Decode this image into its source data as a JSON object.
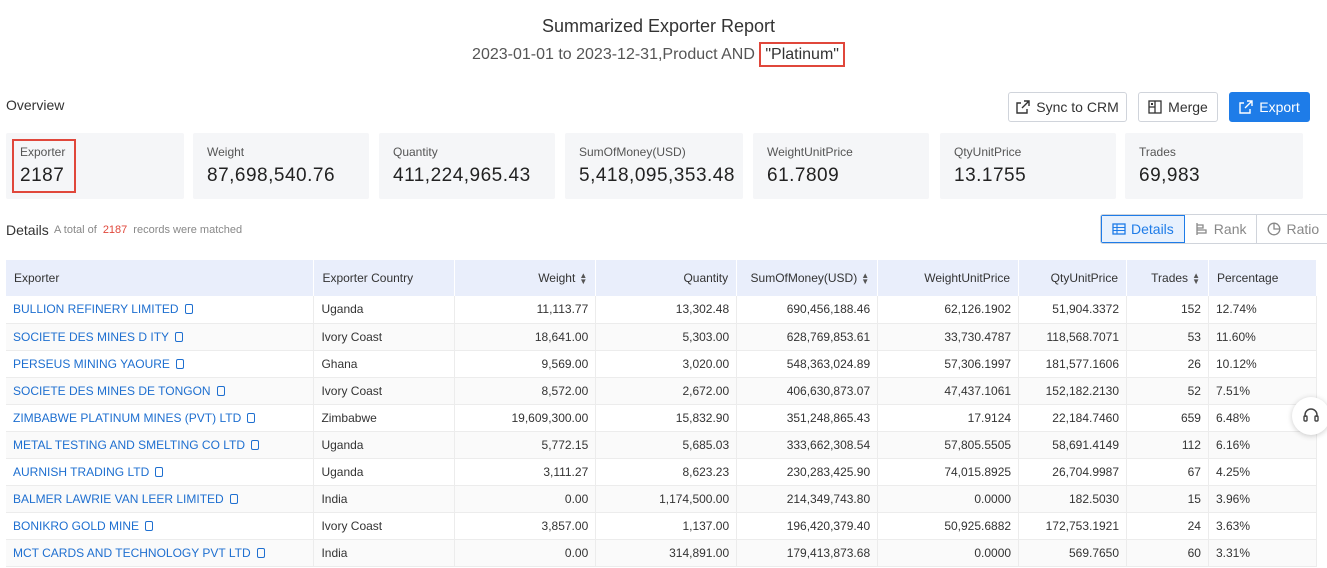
{
  "report": {
    "title": "Summarized Exporter Report",
    "subtitle_prefix": "2023-01-01 to 2023-12-31,Product AND ",
    "keyword": "\"Platinum\""
  },
  "overview": {
    "label": "Overview",
    "buttons": {
      "sync": "Sync to CRM",
      "merge": "Merge",
      "export": "Export"
    },
    "stats": [
      {
        "label": "Exporter",
        "value": "2187"
      },
      {
        "label": "Weight",
        "value": "87,698,540.76"
      },
      {
        "label": "Quantity",
        "value": "411,224,965.43"
      },
      {
        "label": "SumOfMoney(USD)",
        "value": "5,418,095,353.48"
      },
      {
        "label": "WeightUnitPrice",
        "value": "61.7809"
      },
      {
        "label": "QtyUnitPrice",
        "value": "13.1755"
      },
      {
        "label": "Trades",
        "value": "69,983"
      }
    ]
  },
  "details": {
    "label": "Details",
    "note_prefix": "A total of",
    "count": "2187",
    "note_suffix": "records were matched",
    "tabs": {
      "details": "Details",
      "rank": "Rank",
      "ratio": "Ratio"
    }
  },
  "table": {
    "headers": [
      "Exporter",
      "Exporter Country",
      "Weight",
      "Quantity",
      "SumOfMoney(USD)",
      "WeightUnitPrice",
      "QtyUnitPrice",
      "Trades",
      "Percentage"
    ],
    "rows": [
      [
        "BULLION REFINERY LIMITED",
        "Uganda",
        "11,113.77",
        "13,302.48",
        "690,456,188.46",
        "62,126.1902",
        "51,904.3372",
        "152",
        "12.74%"
      ],
      [
        "SOCIETE DES MINES D ITY",
        "Ivory Coast",
        "18,641.00",
        "5,303.00",
        "628,769,853.61",
        "33,730.4787",
        "118,568.7071",
        "53",
        "11.60%"
      ],
      [
        "PERSEUS MINING YAOURE",
        "Ghana",
        "9,569.00",
        "3,020.00",
        "548,363,024.89",
        "57,306.1997",
        "181,577.1606",
        "26",
        "10.12%"
      ],
      [
        "SOCIETE DES MINES DE TONGON",
        "Ivory Coast",
        "8,572.00",
        "2,672.00",
        "406,630,873.07",
        "47,437.1061",
        "152,182.2130",
        "52",
        "7.51%"
      ],
      [
        "ZIMBABWE PLATINUM MINES (PVT) LTD",
        "Zimbabwe",
        "19,609,300.00",
        "15,832.90",
        "351,248,865.43",
        "17.9124",
        "22,184.7460",
        "659",
        "6.48%"
      ],
      [
        "METAL TESTING AND SMELTING CO LTD",
        "Uganda",
        "5,772.15",
        "5,685.03",
        "333,662,308.54",
        "57,805.5505",
        "58,691.4149",
        "112",
        "6.16%"
      ],
      [
        "AURNISH TRADING LTD",
        "Uganda",
        "3,111.27",
        "8,623.23",
        "230,283,425.90",
        "74,015.8925",
        "26,704.9987",
        "67",
        "4.25%"
      ],
      [
        "BALMER LAWRIE VAN LEER LIMITED",
        "India",
        "0.00",
        "1,174,500.00",
        "214,349,743.80",
        "0.0000",
        "182.5030",
        "15",
        "3.96%"
      ],
      [
        "BONIKRO GOLD MINE",
        "Ivory Coast",
        "3,857.00",
        "1,137.00",
        "196,420,379.40",
        "50,925.6882",
        "172,753.1921",
        "24",
        "3.63%"
      ],
      [
        "MCT CARDS AND TECHNOLOGY PVT LTD",
        "India",
        "0.00",
        "314,891.00",
        "179,413,873.68",
        "0.0000",
        "569.7650",
        "60",
        "3.31%"
      ]
    ]
  }
}
